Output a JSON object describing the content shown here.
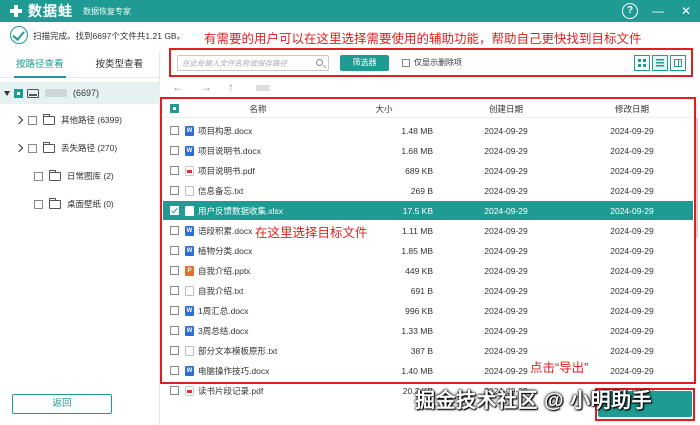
{
  "app": {
    "name": "数据蛙",
    "subtitle": "数据恢复专家"
  },
  "status": {
    "text": "扫描完成。找到6697个文件共1.21 GB。"
  },
  "annotations": {
    "top": "有需要的用户可以在这里选择需要使用的辅助功能，帮助自己更快找到目标文件",
    "middle": "在这里选择目标文件",
    "export": "点击“导出”"
  },
  "sidebar": {
    "tabs": [
      "按路径查看",
      "按类型查看"
    ],
    "root_count": "(6697)",
    "items": [
      {
        "label": "其他路径 (6399)"
      },
      {
        "label": "丢失路径 (270)"
      },
      {
        "label": "日常图库 (2)"
      },
      {
        "label": "桌面壁纸 (0)"
      }
    ],
    "back_label": "返回"
  },
  "toolbar": {
    "search_placeholder": "在此处输入文件名称或保存路径",
    "filter_label": "筛选器",
    "show_deleted_label": "仅显示删除项"
  },
  "table": {
    "headers": {
      "name": "名称",
      "size": "大小",
      "created": "创建日期",
      "modified": "修改日期"
    },
    "rows": [
      {
        "icon": "docx",
        "name": "项目构思.docx",
        "size": "1.48 MB",
        "created": "2024-09-29",
        "modified": "2024-09-29"
      },
      {
        "icon": "docx",
        "name": "项目说明书.docx",
        "size": "1.68 MB",
        "created": "2024-09-29",
        "modified": "2024-09-29"
      },
      {
        "icon": "pdf",
        "name": "项目说明书.pdf",
        "size": "689 KB",
        "created": "2024-09-29",
        "modified": "2024-09-29"
      },
      {
        "icon": "txt",
        "name": "信息备忘.txt",
        "size": "269 B",
        "created": "2024-09-29",
        "modified": "2024-09-29"
      },
      {
        "icon": "xlsx",
        "name": "用户反馈数据收集.xlsx",
        "size": "17.5 KB",
        "created": "2024-09-29",
        "modified": "2024-09-29",
        "selected": true
      },
      {
        "icon": "docx",
        "name": "语段积累.docx",
        "size": "1.11 MB",
        "created": "2024-09-29",
        "modified": "2024-09-29"
      },
      {
        "icon": "docx",
        "name": "植物分类.docx",
        "size": "1.85 MB",
        "created": "2024-09-29",
        "modified": "2024-09-29"
      },
      {
        "icon": "pptx",
        "name": "自我介绍.pptx",
        "size": "449 KB",
        "created": "2024-09-29",
        "modified": "2024-09-29"
      },
      {
        "icon": "txt",
        "name": "自我介绍.txt",
        "size": "691 B",
        "created": "2024-09-29",
        "modified": "2024-09-29"
      },
      {
        "icon": "docx",
        "name": "1周汇总.docx",
        "size": "996 KB",
        "created": "2024-09-29",
        "modified": "2024-09-29"
      },
      {
        "icon": "docx",
        "name": "3周总结.docx",
        "size": "1.33 MB",
        "created": "2024-09-29",
        "modified": "2024-09-29"
      },
      {
        "icon": "txt",
        "name": "部分文本模板原形.txt",
        "size": "387 B",
        "created": "2024-09-29",
        "modified": "2024-09-29"
      },
      {
        "icon": "docx",
        "name": "电脑操作技巧.docx",
        "size": "1.40 MB",
        "created": "2024-09-29",
        "modified": "2024-09-29"
      },
      {
        "icon": "pdf",
        "name": "读书片段记录.pdf",
        "size": "20.3 KB",
        "created": "2024-09-29",
        "modified": "2024-09-29"
      }
    ]
  },
  "footer": {
    "watermark": "掘金技术社区 @ 小明助手"
  },
  "colors": {
    "brand": "#1f9b94",
    "annotation": "#e02020"
  }
}
